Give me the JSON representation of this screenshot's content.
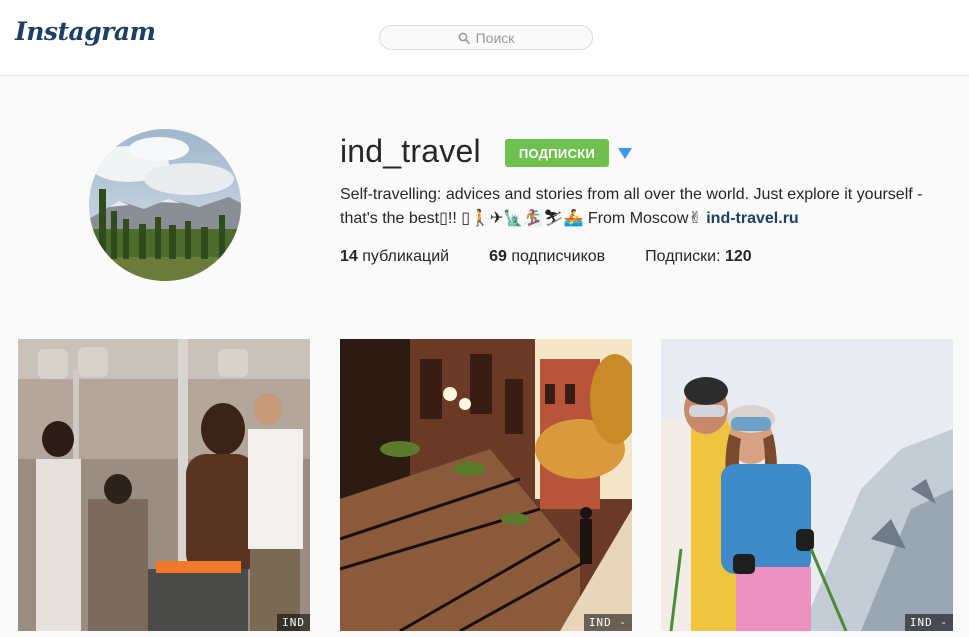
{
  "header": {
    "logo": "Instagram",
    "search_placeholder": "Поиск"
  },
  "profile": {
    "username": "ind_travel",
    "follow_label": "ПОДПИСКИ",
    "bio_text": "Self-travelling: advices and stories from all over the world. Just explore it yourself - that's the best▯!! ▯🚶✈🗽🏂⛷🚣 From Moscow✌",
    "bio_link": "ind-travel.ru",
    "stats": {
      "posts_count": "14",
      "posts_label": " публикаций",
      "followers_count": "69",
      "followers_label": " подписчиков",
      "following_label": "Подписки: ",
      "following_count": "120"
    }
  },
  "posts": [
    {
      "watermark": "IND"
    },
    {
      "watermark": "IND -"
    },
    {
      "watermark": "IND -"
    }
  ],
  "colors": {
    "follow_green": "#70c050",
    "logo_blue": "#1c3f66",
    "dropdown_blue": "#3897f0"
  }
}
